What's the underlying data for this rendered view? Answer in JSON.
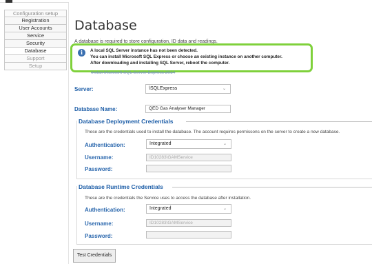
{
  "sidebar": {
    "items": [
      {
        "label": "Configuration setup"
      },
      {
        "label": "Registration"
      },
      {
        "label": "User Accounts"
      },
      {
        "label": "Service"
      },
      {
        "label": "Security"
      },
      {
        "label": "Database"
      },
      {
        "label": "Support"
      },
      {
        "label": "Setup"
      }
    ]
  },
  "page": {
    "title": "Database",
    "intro": "A database is required to store configuration, ID data and readings."
  },
  "callout": {
    "line1": "A local SQL Server instance has not been detected.",
    "line2": "You can install Microsoft SQL Express or choose an existing instance on another computer.",
    "line3": "After downloading and installing SQL Server, reboot the computer.",
    "link": "Install Microsoft SQL Server Express 2014"
  },
  "server": {
    "label": "Server:",
    "value": "\\SQLExpress"
  },
  "database_name": {
    "label": "Database Name:",
    "value": "QED Gas Analyser Manager"
  },
  "deployment": {
    "title": "Database Deployment Credentials",
    "description": "These are the credentials used to install the database. The account requires permissons on the server to create a new database.",
    "auth_label": "Authentication:",
    "auth_value": "Integrated",
    "username_label": "Username:",
    "username_value": "ID10283\\GAMService",
    "password_label": "Password:",
    "password_value": ""
  },
  "runtime": {
    "title": "Database Runtime Credentials",
    "description": "These are the credentials the Service uses to access the database after installation.",
    "auth_label": "Authentication:",
    "auth_value": "Integrated",
    "username_label": "Username:",
    "username_value": "ID10283\\GAMService",
    "password_label": "Password:",
    "password_value": ""
  },
  "buttons": {
    "test_credentials": "Test Credentials"
  },
  "icons": {
    "info": "info-icon",
    "dropdown": "chevron-down-icon"
  },
  "colors": {
    "accent": "#1f5fa8",
    "callout_border": "#7fd13b",
    "info_icon": "#3a6fb0"
  }
}
